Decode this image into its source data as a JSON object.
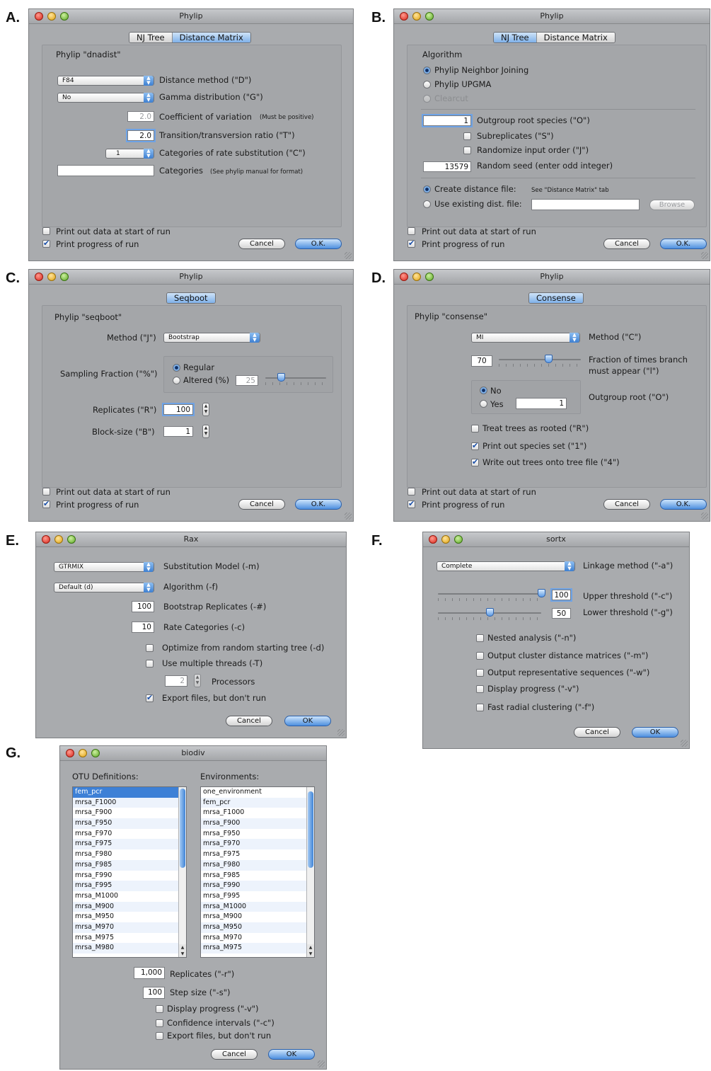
{
  "panel_labels": {
    "a": "A.",
    "b": "B.",
    "c": "C.",
    "d": "D.",
    "e": "E.",
    "f": "F.",
    "g": "G."
  },
  "windows": {
    "a": {
      "title": "Phylip",
      "tabs": [
        "NJ Tree",
        "Distance Matrix"
      ],
      "group_title": "Phylip \"dnadist\"",
      "distance_method": {
        "value": "F84",
        "label": "Distance method (\"D\")"
      },
      "gamma": {
        "value": "No",
        "label": "Gamma distribution (\"G\")"
      },
      "coef_var": {
        "value": "2.0",
        "label": "Coefficient of variation",
        "note": "(Must be positive)"
      },
      "ratio": {
        "value": "2.0",
        "label": "Transition/transversion ratio (\"T\")"
      },
      "categories_rate": {
        "value": "1",
        "label": "Categories of rate substitution (\"C\")"
      },
      "categories": {
        "value": "",
        "label": "Categories",
        "note": "(See phylip manual for format)"
      },
      "print_data": "Print out data at start of run",
      "print_progress": "Print progress of run",
      "cancel": "Cancel",
      "ok": "O.K."
    },
    "b": {
      "title": "Phylip",
      "tabs": [
        "NJ Tree",
        "Distance Matrix"
      ],
      "algorithm_title": "Algorithm",
      "radio_nj": "Phylip Neighbor Joining",
      "radio_upgma": "Phylip UPGMA",
      "radio_clearcut": "Clearcut",
      "outgroup": {
        "value": "1",
        "label": "Outgroup root species (\"O\")"
      },
      "subreplicates": "Subreplicates (\"S\")",
      "randomize": "Randomize input order (\"J\")",
      "seed": {
        "value": "13579",
        "label": "Random seed (enter odd integer)"
      },
      "create_file": "Create distance file:",
      "create_note": "See \"Distance Matrix\" tab",
      "use_existing": "Use existing dist. file:",
      "browse": "Browse",
      "print_data": "Print out data at start of run",
      "print_progress": "Print progress of run",
      "cancel": "Cancel",
      "ok": "O.K."
    },
    "c": {
      "title": "Phylip",
      "tab": "Seqboot",
      "group_title": "Phylip \"seqboot\"",
      "method_label": "Method (\"J\")",
      "method_value": "Bootstrap",
      "sampling_label": "Sampling Fraction (\"%\")",
      "regular": "Regular",
      "altered": "Altered (%)",
      "altered_value": "25",
      "altered_slider_fraction": 0.25,
      "replicates_label": "Replicates (\"R\")",
      "replicates_value": "100",
      "block_label": "Block-size (\"B\")",
      "block_value": "1",
      "print_data": "Print out data at start of run",
      "print_progress": "Print progress of run",
      "cancel": "Cancel",
      "ok": "O.K."
    },
    "d": {
      "title": "Phylip",
      "tab": "Consense",
      "group_title": "Phylip \"consense\"",
      "method_value": "MI",
      "method_label": "Method (\"C\")",
      "fraction_value": "70",
      "fraction_slider_fraction": 0.6,
      "fraction_label": "Fraction of times branch",
      "fraction_label2": "must appear (\"l\")",
      "no": "No",
      "yes": "Yes",
      "outgroup_value": "1",
      "outgroup_label": "Outgroup root (\"O\")",
      "treat_rooted": "Treat trees as rooted (\"R\")",
      "print_species": "Print out species set (\"1\")",
      "write_trees": "Write out trees onto tree file (\"4\")",
      "print_data": "Print out data at start of run",
      "print_progress": "Print progress of run",
      "cancel": "Cancel",
      "ok": "O.K."
    },
    "e": {
      "title": "Rax",
      "model_value": "GTRMIX",
      "model_label": "Substitution Model (-m)",
      "algorithm_value": "Default (d)",
      "algorithm_label": "Algorithm (-f)",
      "bootstrap_value": "100",
      "bootstrap_label": "Bootstrap Replicates (-#)",
      "rate_value": "10",
      "rate_label": "Rate Categories (-c)",
      "optimize": "Optimize from random starting tree (-d)",
      "threads": "Use multiple threads (-T)",
      "processors_value": "2",
      "processors_label": "Processors",
      "export": "Export files, but don't run",
      "cancel": "Cancel",
      "ok": "OK"
    },
    "f": {
      "title": "sortx",
      "linkage_value": "Complete",
      "linkage_label": "Linkage method (\"-a\")",
      "upper_value": "100",
      "upper_label": "Upper threshold (\"-c\")",
      "upper_fraction": 1.0,
      "lower_value": "50",
      "lower_label": "Lower threshold (\"-g\")",
      "lower_fraction": 0.5,
      "nested": "Nested analysis (\"-n\")",
      "output_matrices": "Output cluster distance matrices (\"-m\")",
      "output_reps": "Output representative sequences (\"-w\")",
      "display_progress": "Display progress (\"-v\")",
      "fast_radial": "Fast radial clustering (\"-f\")",
      "cancel": "Cancel",
      "ok": "OK"
    },
    "g": {
      "title": "biodiv",
      "otu_label": "OTU Definitions:",
      "env_label": "Environments:",
      "otu_items": [
        "fem_pcr",
        "mrsa_F1000",
        "mrsa_F900",
        "mrsa_F950",
        "mrsa_F970",
        "mrsa_F975",
        "mrsa_F980",
        "mrsa_F985",
        "mrsa_F990",
        "mrsa_F995",
        "mrsa_M1000",
        "mrsa_M900",
        "mrsa_M950",
        "mrsa_M970",
        "mrsa_M975",
        "mrsa_M980"
      ],
      "env_items": [
        "one_environment",
        "fem_pcr",
        "mrsa_F1000",
        "mrsa_F900",
        "mrsa_F950",
        "mrsa_F970",
        "mrsa_F975",
        "mrsa_F980",
        "mrsa_F985",
        "mrsa_F990",
        "mrsa_F995",
        "mrsa_M1000",
        "mrsa_M900",
        "mrsa_M950",
        "mrsa_M970",
        "mrsa_M975"
      ],
      "replicates_value": "1,000",
      "replicates_label": "Replicates (\"-r\")",
      "step_value": "100",
      "step_label": "Step size (\"-s\")",
      "display_progress": "Display progress (\"-v\")",
      "confidence": "Confidence intervals (\"-c\")",
      "export": "Export files, but don't run",
      "cancel": "Cancel",
      "ok": "OK"
    }
  }
}
